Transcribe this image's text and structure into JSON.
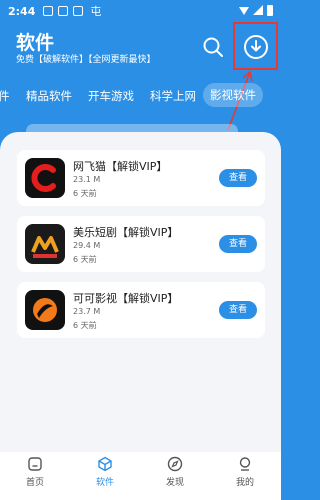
{
  "status": {
    "time": "2:44",
    "extra_glyph": "屯"
  },
  "header": {
    "title": "软件",
    "subtitle": "免费【破解软件】【全网更新最快】"
  },
  "tabs": [
    {
      "label": "件"
    },
    {
      "label": "精品软件"
    },
    {
      "label": "开车游戏"
    },
    {
      "label": "科学上网"
    },
    {
      "label": "影视软件",
      "active": true
    }
  ],
  "apps": [
    {
      "name": "网飞猫【解锁VIP】",
      "size": "23.1 M",
      "time": "6 天前",
      "button": "查看"
    },
    {
      "name": "美乐短剧【解锁VIP】",
      "size": "29.4 M",
      "time": "6 天前",
      "button": "查看"
    },
    {
      "name": "可可影视【解锁VIP】",
      "size": "23.7 M",
      "time": "6 天前",
      "button": "查看"
    }
  ],
  "nav": [
    {
      "label": "首页"
    },
    {
      "label": "软件",
      "active": true
    },
    {
      "label": "发现"
    },
    {
      "label": "我的"
    }
  ],
  "colors": {
    "accent": "#2b8fe6",
    "highlight": "#e53935"
  }
}
